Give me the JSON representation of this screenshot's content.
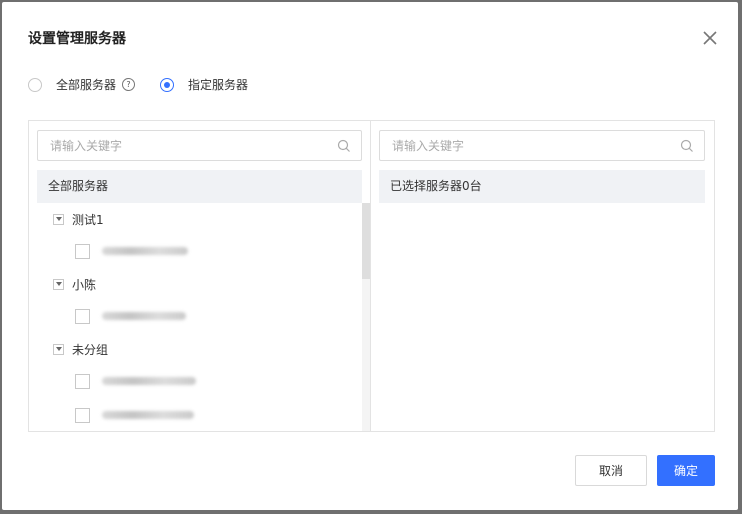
{
  "dialog": {
    "title": "设置管理服务器",
    "radios": {
      "all_label": "全部服务器",
      "specified_label": "指定服务器",
      "selected": "specified"
    },
    "help_icon": "question-circle-icon",
    "left_panel": {
      "search_placeholder": "请输入关键字",
      "group_header": "全部服务器",
      "groups": [
        {
          "label": "测试1"
        },
        {
          "label": "小陈"
        },
        {
          "label": "未分组"
        }
      ]
    },
    "right_panel": {
      "search_placeholder": "请输入关键字",
      "selected_summary": "已选择服务器0台"
    },
    "buttons": {
      "cancel_label": "取消",
      "ok_label": "确定"
    },
    "accent_color": "#3370ff"
  }
}
